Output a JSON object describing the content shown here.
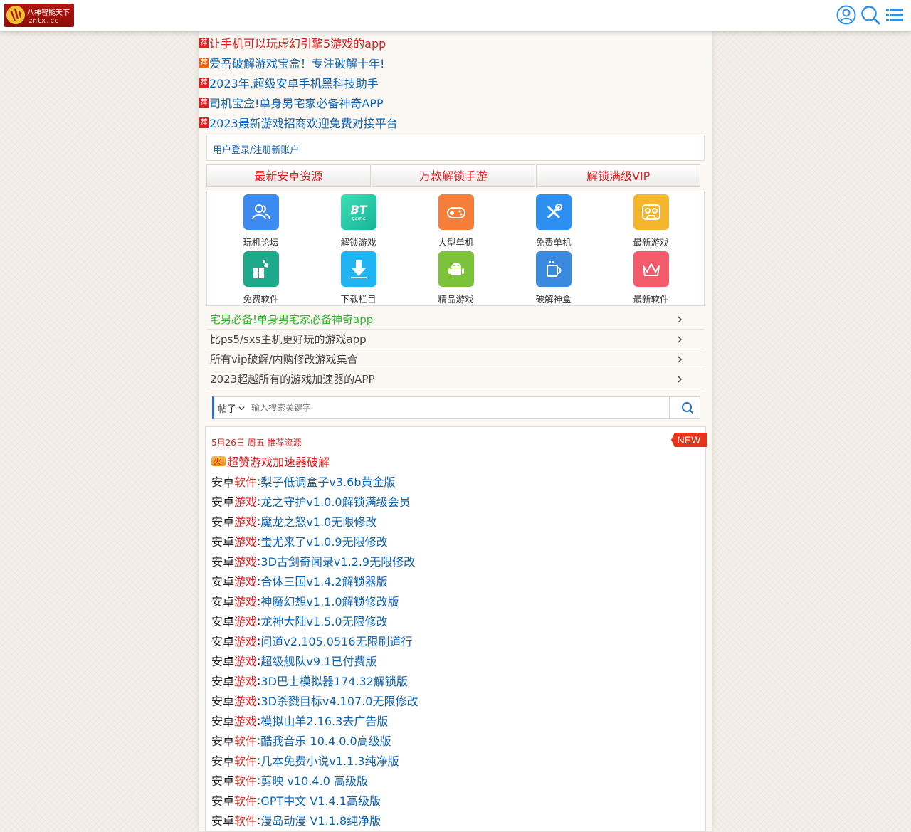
{
  "header": {
    "logo_cn": "八神智能天下",
    "logo_en": "zntx.cc",
    "icons": [
      "user-icon",
      "search-icon",
      "menu-list-icon"
    ]
  },
  "promos": [
    {
      "tag": "荐",
      "text": "让手机可以玩虚幻引擎5游戏的app",
      "color": "#e21b1b"
    },
    {
      "tag": "荐",
      "text": "爱吾破解游戏宝盒！专注破解十年!",
      "color": "#0b63b6"
    },
    {
      "tag": "荐",
      "text": "2023年,超级安卓手机黑科技助手",
      "color": "#0b63b6"
    },
    {
      "tag": "荐",
      "text": "司机宝盒!单身男宅家必备神奇APP",
      "color": "#0b63b6"
    },
    {
      "tag": "荐",
      "text": "2023最新游戏招商欢迎免费对接平台",
      "color": "#0b63b6"
    }
  ],
  "login": {
    "text": "用户登录/注册新账户"
  },
  "tabs": [
    "最新安卓资源",
    "万款解锁手游",
    "解锁满级VIP"
  ],
  "grid": [
    {
      "label": "玩机论坛",
      "icon": "users-icon",
      "color": "#3d8bf0"
    },
    {
      "label": "解锁游戏",
      "icon": "bt-game-icon",
      "color": "#22c6a6"
    },
    {
      "label": "大型单机",
      "icon": "gamepad-icon",
      "color": "#f57e3a"
    },
    {
      "label": "免费单机",
      "icon": "tools-icon",
      "color": "#2d8ff0"
    },
    {
      "label": "最新游戏",
      "icon": "controller-icon",
      "color": "#f5b52c"
    },
    {
      "label": "免费软件",
      "icon": "cubes-icon",
      "color": "#1ea98a"
    },
    {
      "label": "下载栏目",
      "icon": "download-icon",
      "color": "#21b4f2"
    },
    {
      "label": "精品游戏",
      "icon": "android-icon",
      "color": "#7cc23a"
    },
    {
      "label": "破解神盒",
      "icon": "cup-icon",
      "color": "#3a8be0"
    },
    {
      "label": "最新软件",
      "icon": "crown-icon",
      "color": "#f35a6a"
    }
  ],
  "links": [
    {
      "text": "宅男必备!单身男宅家必备神奇app",
      "color": "#2db52d"
    },
    {
      "text": "比ps5/sxs主机更好玩的游戏app",
      "color": "#444"
    },
    {
      "text": "所有vip破解/内购修改游戏集合",
      "color": "#444"
    },
    {
      "text": "2023超越所有的游戏加速器的APP",
      "color": "#444"
    }
  ],
  "search": {
    "type": "帖子",
    "placeholder": "输入搜索关键字"
  },
  "news": {
    "date": "5月26日 周五 推荐资源",
    "badge": "NEW",
    "hot": "超赞游戏加速器破解",
    "items": [
      {
        "pre": "安卓",
        "cat": "软件",
        "title": "梨子低调盒子v3.6b黄金版"
      },
      {
        "pre": "安卓",
        "cat": "游戏",
        "title": "龙之守护v1.0.0解锁满级会员"
      },
      {
        "pre": "安卓",
        "cat": "游戏",
        "title": "魔龙之怒v1.0无限修改"
      },
      {
        "pre": "安卓",
        "cat": "游戏",
        "title": "蚩尤来了v1.0.9无限修改"
      },
      {
        "pre": "安卓",
        "cat": "游戏",
        "title": "3D古剑奇闻录v1.2.9无限修改"
      },
      {
        "pre": "安卓",
        "cat": "游戏",
        "title": "合体三国v1.4.2解锁器版"
      },
      {
        "pre": "安卓",
        "cat": "游戏",
        "title": "神魔幻想v1.1.0解锁修改版"
      },
      {
        "pre": "安卓",
        "cat": "游戏",
        "title": "龙神大陆v1.5.0无限修改"
      },
      {
        "pre": "安卓",
        "cat": "游戏",
        "title": "问道v2.105.0516无限刷道行"
      },
      {
        "pre": "安卓",
        "cat": "游戏",
        "title": "超级舰队v9.1已付费版"
      },
      {
        "pre": "安卓",
        "cat": "游戏",
        "title": "3D巴士模拟器174.32解锁版"
      },
      {
        "pre": "安卓",
        "cat": "游戏",
        "title": "3D杀戮目标v4.107.0无限修改"
      },
      {
        "pre": "安卓",
        "cat": "游戏",
        "title": "模拟山羊2.16.3去广告版"
      },
      {
        "pre": "安卓",
        "cat": "软件",
        "title": "酷我音乐 10.4.0.0高级版"
      },
      {
        "pre": "安卓",
        "cat": "软件",
        "title": "几本免费小说v1.1.3纯净版"
      },
      {
        "pre": "安卓",
        "cat": "软件",
        "title": "剪映 v10.4.0 高级版"
      },
      {
        "pre": "安卓",
        "cat": "软件",
        "title": "GPT中文 V1.4.1高级版"
      },
      {
        "pre": "安卓",
        "cat": "软件",
        "title": "漫岛动漫 V1.1.8纯净版"
      }
    ]
  }
}
